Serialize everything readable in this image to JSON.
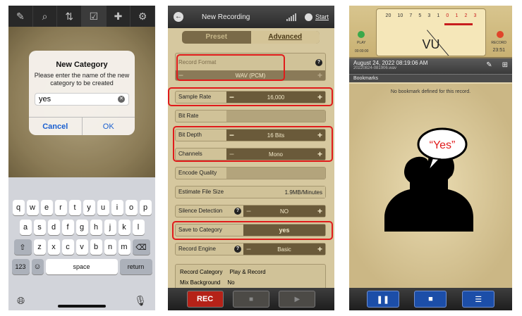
{
  "phone1": {
    "toolbar": [
      "✎",
      "⌕",
      "⇅",
      "☑",
      "✚",
      "⚙"
    ],
    "dialog": {
      "title": "New Category",
      "message": "Please enter the name of the new category to be created",
      "input_value": "yes",
      "cancel": "Cancel",
      "ok": "OK"
    },
    "keyboard": {
      "row1": [
        "q",
        "w",
        "e",
        "r",
        "t",
        "y",
        "u",
        "i",
        "o",
        "p"
      ],
      "row2": [
        "a",
        "s",
        "d",
        "f",
        "g",
        "h",
        "j",
        "k",
        "l"
      ],
      "row3": [
        "z",
        "x",
        "c",
        "v",
        "b",
        "n",
        "m"
      ],
      "key_123": "123",
      "key_space": "space",
      "key_return": "return"
    }
  },
  "phone2": {
    "title": "New Recording",
    "start_label": "Start",
    "tab_preset": "Preset",
    "tab_advanced": "Advanced",
    "record_format_label": "Record Format",
    "record_format_value": "WAV (PCM)",
    "sample_rate_label": "Sample Rate",
    "sample_rate_value": "16,000",
    "bit_rate_label": "Bit Rate",
    "bit_depth_label": "Bit Depth",
    "bit_depth_value": "16 Bits",
    "channels_label": "Channels",
    "channels_value": "Mono",
    "encode_quality_label": "Encode Quality",
    "file_size_label": "Estimate File Size",
    "file_size_value": "1.9MB/Minutes",
    "silence_label": "Silence Detection",
    "silence_value": "NO",
    "category_label": "Save to Category",
    "category_value": "yes",
    "engine_label": "Record Engine",
    "engine_value": "Basic",
    "record_category_label": "Record Category",
    "record_category_value": "Play & Record",
    "mix_background_label": "Mix Background",
    "mix_background_value": "No",
    "rec_button": "REC"
  },
  "phone3": {
    "vu_scale": [
      "20",
      "10",
      "7",
      "5",
      "3",
      "1",
      "0",
      "1",
      "2",
      "3"
    ],
    "vu_label": "VU",
    "play_label": "PLAY",
    "record_label": "RECORD",
    "time_left": "00:00:00",
    "time_right": "23:51",
    "datetime": "August 24, 2022 08:19:06 AM",
    "filename": "20220824-081906.wav",
    "bookmarks_header": "Bookmarks",
    "no_bookmark_text": "No bookmark defined for this record.",
    "speech_text": "“Yes”"
  }
}
